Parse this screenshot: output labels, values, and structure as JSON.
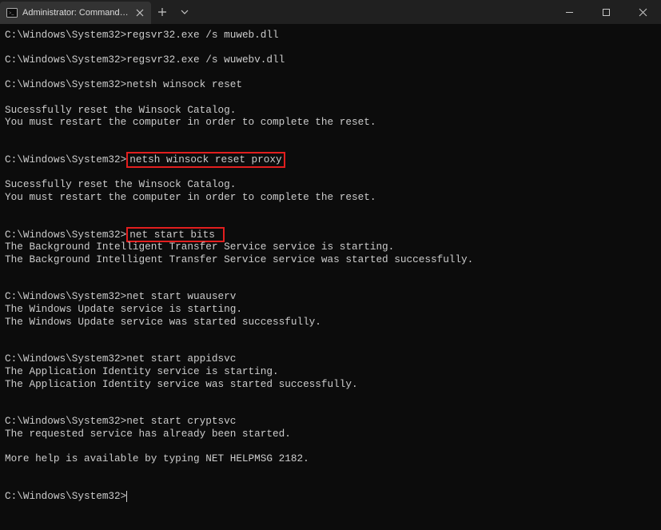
{
  "window": {
    "tab_title": "Administrator: Command Promp"
  },
  "icons": {
    "close_x": "✕",
    "plus": "＋",
    "chevron_down": "⌄",
    "minimize": "—",
    "maximize": "☐"
  },
  "terminal": {
    "prompt": "C:\\Windows\\System32>",
    "lines": [
      {
        "type": "cmd",
        "prompt": "C:\\Windows\\System32>",
        "cmd": "regsvr32.exe /s muweb.dll"
      },
      {
        "type": "blank"
      },
      {
        "type": "cmd",
        "prompt": "C:\\Windows\\System32>",
        "cmd": "regsvr32.exe /s wuwebv.dll"
      },
      {
        "type": "blank"
      },
      {
        "type": "cmd",
        "prompt": "C:\\Windows\\System32>",
        "cmd": "netsh winsock reset"
      },
      {
        "type": "blank"
      },
      {
        "type": "out",
        "text": "Sucessfully reset the Winsock Catalog."
      },
      {
        "type": "out",
        "text": "You must restart the computer in order to complete the reset."
      },
      {
        "type": "blank"
      },
      {
        "type": "blank"
      },
      {
        "type": "cmd_hl",
        "prompt": "C:\\Windows\\System32>",
        "cmd": "netsh winsock reset proxy"
      },
      {
        "type": "blank"
      },
      {
        "type": "out",
        "text": "Sucessfully reset the Winsock Catalog."
      },
      {
        "type": "out",
        "text": "You must restart the computer in order to complete the reset."
      },
      {
        "type": "blank"
      },
      {
        "type": "blank"
      },
      {
        "type": "cmd_hl",
        "prompt": "C:\\Windows\\System32>",
        "cmd": "net start bits "
      },
      {
        "type": "out",
        "text": "The Background Intelligent Transfer Service service is starting."
      },
      {
        "type": "out",
        "text": "The Background Intelligent Transfer Service service was started successfully."
      },
      {
        "type": "blank"
      },
      {
        "type": "blank"
      },
      {
        "type": "cmd",
        "prompt": "C:\\Windows\\System32>",
        "cmd": "net start wuauserv"
      },
      {
        "type": "out",
        "text": "The Windows Update service is starting."
      },
      {
        "type": "out",
        "text": "The Windows Update service was started successfully."
      },
      {
        "type": "blank"
      },
      {
        "type": "blank"
      },
      {
        "type": "cmd",
        "prompt": "C:\\Windows\\System32>",
        "cmd": "net start appidsvc"
      },
      {
        "type": "out",
        "text": "The Application Identity service is starting."
      },
      {
        "type": "out",
        "text": "The Application Identity service was started successfully."
      },
      {
        "type": "blank"
      },
      {
        "type": "blank"
      },
      {
        "type": "cmd",
        "prompt": "C:\\Windows\\System32>",
        "cmd": "net start cryptsvc"
      },
      {
        "type": "out",
        "text": "The requested service has already been started."
      },
      {
        "type": "blank"
      },
      {
        "type": "out",
        "text": "More help is available by typing NET HELPMSG 2182."
      },
      {
        "type": "blank"
      },
      {
        "type": "blank"
      },
      {
        "type": "prompt_only",
        "prompt": "C:\\Windows\\System32>"
      }
    ]
  }
}
